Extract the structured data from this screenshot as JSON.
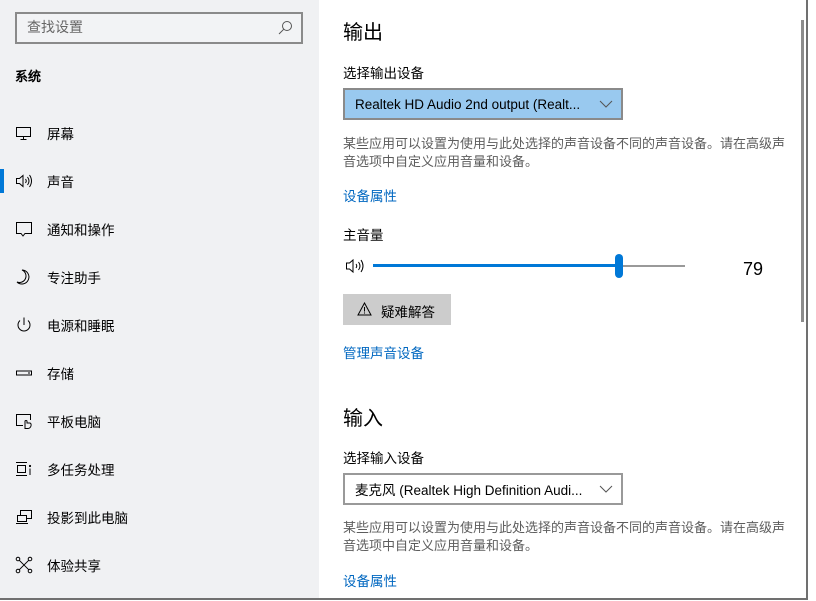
{
  "sidebar": {
    "search": {
      "placeholder": "查找设置",
      "value": ""
    },
    "section_label": "系统",
    "items": [
      {
        "label": "屏幕",
        "icon": "display-icon",
        "active": false
      },
      {
        "label": "声音",
        "icon": "speaker-icon",
        "active": true
      },
      {
        "label": "通知和操作",
        "icon": "notification-icon",
        "active": false
      },
      {
        "label": "专注助手",
        "icon": "moon-icon",
        "active": false
      },
      {
        "label": "电源和睡眠",
        "icon": "power-icon",
        "active": false
      },
      {
        "label": "存储",
        "icon": "storage-icon",
        "active": false
      },
      {
        "label": "平板电脑",
        "icon": "tablet-icon",
        "active": false
      },
      {
        "label": "多任务处理",
        "icon": "multitasking-icon",
        "active": false
      },
      {
        "label": "投影到此电脑",
        "icon": "project-icon",
        "active": false
      },
      {
        "label": "体验共享",
        "icon": "shared-experience-icon",
        "active": false
      }
    ]
  },
  "output": {
    "heading": "输出",
    "select_label": "选择输出设备",
    "device": "Realtek HD Audio 2nd output (Realt...",
    "description": "某些应用可以设置为使用与此处选择的声音设备不同的声音设备。请在高级声音选项中自定义应用音量和设备。",
    "properties_link": "设备属性",
    "volume_label": "主音量",
    "volume": 79,
    "volume_max": 100,
    "troubleshoot_label": "疑难解答",
    "manage_link": "管理声音设备"
  },
  "input": {
    "heading": "输入",
    "select_label": "选择输入设备",
    "device": "麦克风 (Realtek High Definition Audi...",
    "description": "某些应用可以设置为使用与此处选择的声音设备不同的声音设备。请在高级声音选项中自定义应用音量和设备。",
    "properties_link": "设备属性"
  },
  "colors": {
    "accent": "#0078d7",
    "link": "#0067c0",
    "dropdown_selected": "#99c9ef"
  }
}
